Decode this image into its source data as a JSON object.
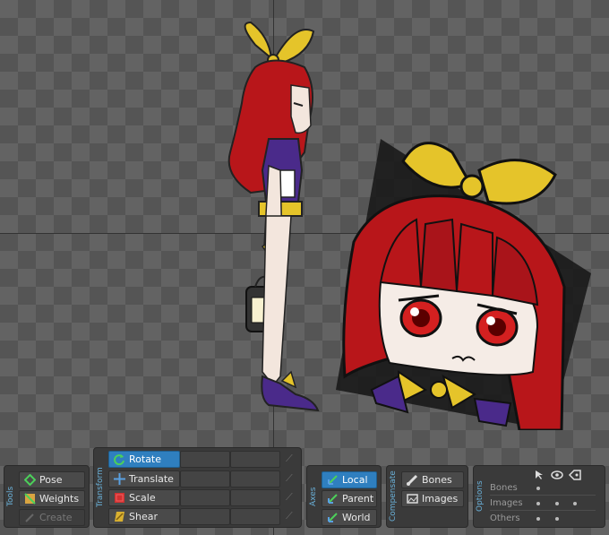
{
  "tools": {
    "label": "Tools",
    "pose": "Pose",
    "weights": "Weights",
    "create": "Create"
  },
  "transform": {
    "label": "Transform",
    "rotate": "Rotate",
    "translate": "Translate",
    "scale": "Scale",
    "shear": "Shear"
  },
  "axes": {
    "label": "Axes",
    "local": "Local",
    "parent": "Parent",
    "world": "World"
  },
  "compensate": {
    "label": "Compensate",
    "bones": "Bones",
    "images": "Images"
  },
  "options": {
    "label": "Options",
    "rows": [
      "Bones",
      "Images",
      "Others"
    ]
  },
  "colors": {
    "accent": "#2f7fbf",
    "label_blue": "#6ab0d8"
  }
}
